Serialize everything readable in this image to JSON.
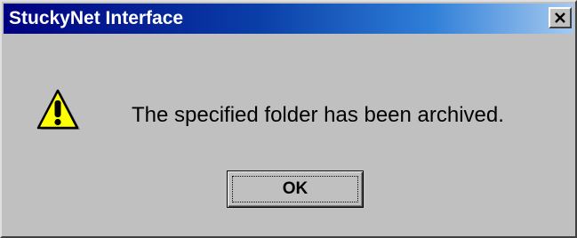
{
  "window": {
    "title": "StuckyNet Interface",
    "close_icon": "close-icon"
  },
  "dialog": {
    "icon": "warning-icon",
    "message": "The specified folder has been archived.",
    "ok_label": "OK"
  },
  "colors": {
    "titlebar_start": "#000080",
    "titlebar_end": "#a6caf0",
    "dialog_face": "#c0c0c0",
    "warning_yellow": "#ffff00"
  }
}
